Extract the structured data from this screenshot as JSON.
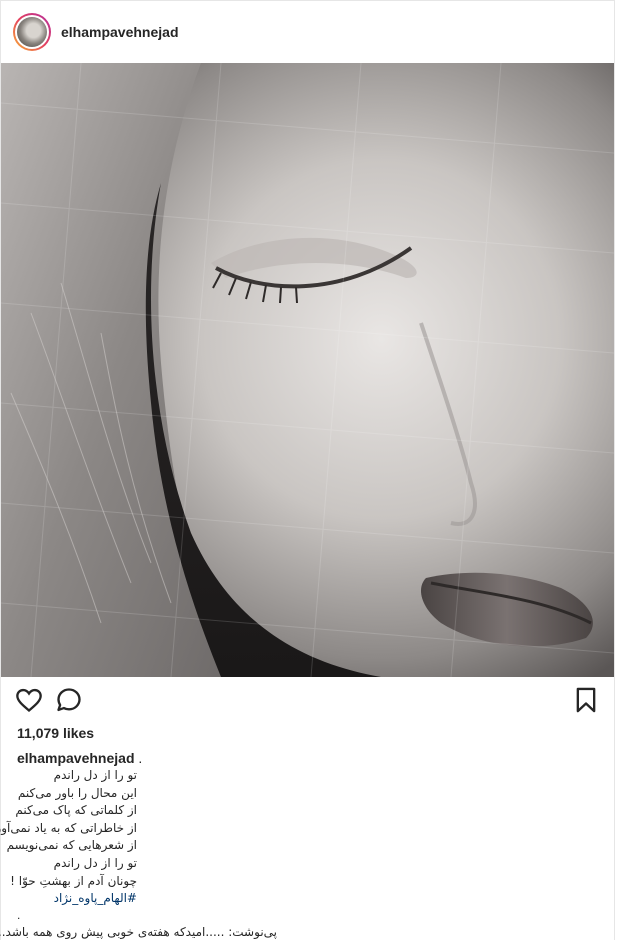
{
  "header": {
    "username": "elhampavehnejad"
  },
  "post": {
    "likes": "11,079 likes"
  },
  "caption": {
    "author": "elhampavehnejad",
    "author_suffix": " .",
    "lines": [
      "تو را از دل راندم",
      "این محال را باور می‌کنم",
      "از کلماتی که پاک می‌کنم",
      "از خاطراتی که به یاد نمی‌آورم",
      "از شعرهایی که نمی‌نویسم",
      "تو را از دل راندم",
      "چونان آدم از بهشتِ حوّا !"
    ],
    "hashtag": "#الهام_پاوه_نژاد",
    "separator": ".",
    "postscript": "پی‌نوشت: .....امیدکه هفته‌ی خوبی پیش روی همه باشد..."
  },
  "icons": {
    "like": "heart-icon",
    "comment": "comment-icon",
    "save": "bookmark-icon"
  },
  "colors": {
    "text": "#262626",
    "hashtag": "#003569",
    "border": "#e6e6e6"
  }
}
